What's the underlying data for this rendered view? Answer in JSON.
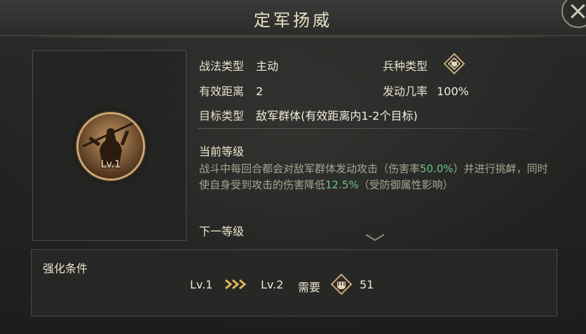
{
  "title": "定军扬威",
  "portrait": {
    "level": "Lv.1"
  },
  "info": {
    "type_label": "战法类型",
    "type_value": "主动",
    "range_label": "有效距离",
    "range_value": "2",
    "target_label": "目标类型",
    "target_value": "敌军群体(有效距离内1-2个目标)",
    "troop_label": "兵种类型",
    "trigger_label": "发动几率",
    "trigger_value": "100%"
  },
  "current": {
    "heading": "当前等级",
    "desc_1": "战斗中每回合都会对敌军群体发动攻击（伤害率",
    "damage_rate": "50.0%",
    "desc_2": "）并进行挑衅，同时使自身受到攻击的伤害降低",
    "reduction": "12.5%",
    "desc_3": "（受防御属性影响）"
  },
  "next": {
    "heading": "下一等级"
  },
  "upgrade": {
    "title": "强化条件",
    "from": "Lv.1",
    "to": "Lv.2",
    "need_label": "需要",
    "amount": "51"
  },
  "colors": {
    "highlight": "#6fbf86",
    "gold": "#c9a878"
  },
  "icons": {
    "close": "close-icon",
    "troop": "troop-type-icon",
    "material": "material-icon",
    "arrow": "triple-chevron-icon",
    "scroll": "scroll-down-icon"
  }
}
